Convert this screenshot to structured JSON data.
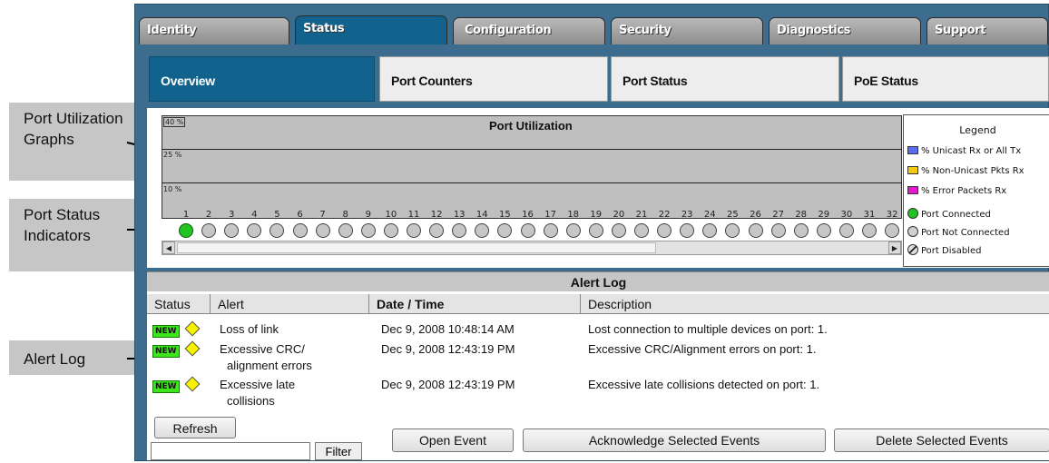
{
  "callouts": {
    "graphs": "Port Utilization Graphs",
    "status": "Port Status Indicators",
    "alert": "Alert Log"
  },
  "tabs": [
    {
      "label": "Identity",
      "active": false
    },
    {
      "label": "Status",
      "active": true
    },
    {
      "label": "Configuration",
      "active": false
    },
    {
      "label": "Security",
      "active": false
    },
    {
      "label": "Diagnostics",
      "active": false
    },
    {
      "label": "Support",
      "active": false
    }
  ],
  "subtabs": [
    {
      "label": "Overview",
      "active": true
    },
    {
      "label": "Port Counters",
      "active": false
    },
    {
      "label": "Port Status",
      "active": false
    },
    {
      "label": "PoE Status",
      "active": false
    }
  ],
  "graph": {
    "title": "Port Utilization",
    "levels": [
      "40 %",
      "25 %",
      "10 %"
    ]
  },
  "ports": {
    "numbers": [
      "1",
      "2",
      "3",
      "4",
      "5",
      "6",
      "7",
      "8",
      "9",
      "10",
      "11",
      "12",
      "13",
      "14",
      "15",
      "16",
      "17",
      "18",
      "19",
      "20",
      "21",
      "22",
      "23",
      "24",
      "25",
      "26",
      "27",
      "28",
      "29",
      "30",
      "31",
      "32"
    ],
    "connected": [
      1
    ]
  },
  "legend": {
    "title": "Legend",
    "items": [
      {
        "label": "% Unicast Rx or All Tx",
        "color": "#5a6cf0"
      },
      {
        "label": "% Non-Unicast Pkts Rx",
        "color": "#f2c90c"
      },
      {
        "label": "% Error Packets Rx",
        "color": "#e51ad0"
      }
    ],
    "status": {
      "connected": "Port Connected",
      "not_connected": "Port Not Connected",
      "disabled": "Port Disabled"
    }
  },
  "alert_log": {
    "title": "Alert Log",
    "columns": {
      "status": "Status",
      "alert": "Alert",
      "datetime": "Date / Time",
      "description": "Description"
    },
    "badge": "NEW",
    "rows": [
      {
        "alert": "Loss of link",
        "alert2": "",
        "datetime": "Dec 9, 2008 10:48:14 AM",
        "description": "Lost connection to multiple devices on port: 1."
      },
      {
        "alert": "Excessive CRC/",
        "alert2": "alignment errors",
        "datetime": "Dec 9, 2008 12:43:19 PM",
        "description": "Excessive CRC/Alignment errors on port: 1."
      },
      {
        "alert": "Excessive late",
        "alert2": "collisions",
        "datetime": "Dec 9, 2008 12:43:19 PM",
        "description": "Excessive late collisions detected on port: 1."
      }
    ],
    "buttons": {
      "refresh": "Refresh",
      "filter": "Filter",
      "open": "Open Event",
      "ack": "Acknowledge Selected Events",
      "delete": "Delete Selected Events"
    }
  },
  "colors": {
    "brand_blue": "#11628c",
    "frame_blue": "#3d6d8e",
    "graph_gray": "#bfbfbf"
  }
}
